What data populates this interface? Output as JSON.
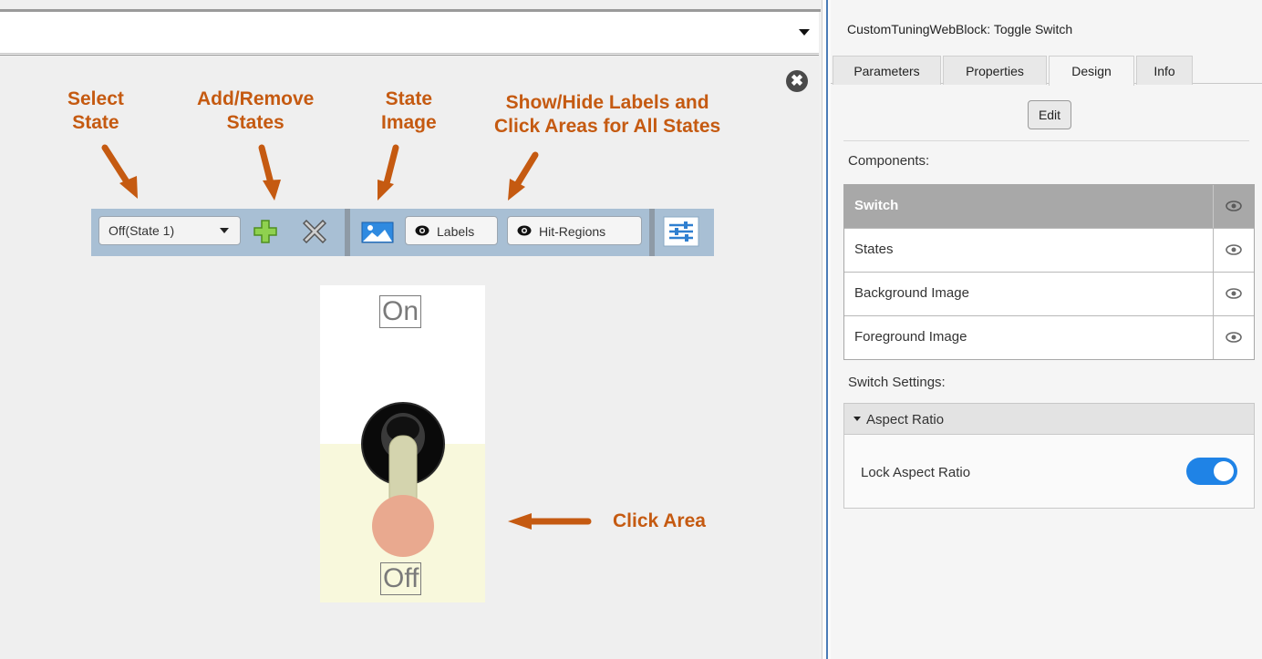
{
  "canvas": {
    "close_glyph": "✖",
    "annotations": {
      "select_state": [
        "Select",
        "State"
      ],
      "add_remove": [
        "Add/Remove",
        "States"
      ],
      "state_image": [
        "State",
        "Image"
      ],
      "show_hide": [
        "Show/Hide Labels and",
        "Click Areas for All States"
      ],
      "click_area": "Click Area"
    },
    "toolbar": {
      "state_select_value": "Off(State 1)",
      "labels_button": "Labels",
      "hit_regions_button": "Hit-Regions"
    },
    "switch_labels": {
      "on": "On",
      "off": "Off"
    }
  },
  "panel": {
    "title": "CustomTuningWebBlock: Toggle Switch",
    "tabs": [
      {
        "label": "Parameters",
        "active": false
      },
      {
        "label": "Properties",
        "active": false
      },
      {
        "label": "Design",
        "active": true
      },
      {
        "label": "Info",
        "active": false
      }
    ],
    "edit_button": "Edit",
    "components_label": "Components:",
    "components": [
      {
        "name": "Switch",
        "selected": true
      },
      {
        "name": "States",
        "selected": false
      },
      {
        "name": "Background Image",
        "selected": false
      },
      {
        "name": "Foreground Image",
        "selected": false
      }
    ],
    "switch_settings_label": "Switch Settings:",
    "aspect_section": "Aspect Ratio",
    "lock_aspect_label": "Lock Aspect Ratio",
    "lock_aspect_on": true
  },
  "colors": {
    "annotation": "#c55a11",
    "toolbar": "#a8bfd4",
    "toggle_on": "#1f83e6",
    "selected_row": "#a8a8a8",
    "click_area": "#e9a98f",
    "lower_state_bg": "#f8f8dc"
  },
  "icons": [
    "close-circle-icon",
    "dropdown-arrow-icon",
    "plus-icon",
    "x-icon",
    "image-icon",
    "eye-icon",
    "settings-sliders-icon",
    "triangle-down-icon"
  ]
}
